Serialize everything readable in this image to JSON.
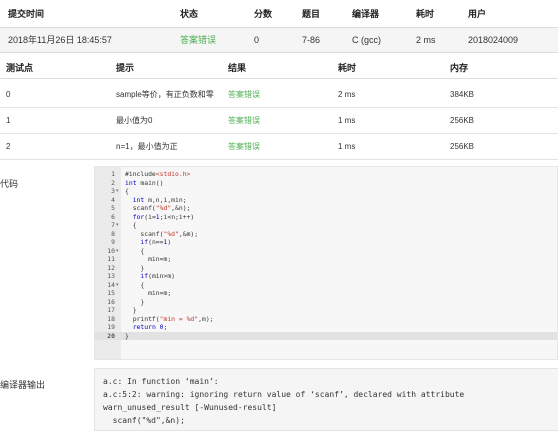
{
  "submission": {
    "headers": [
      "提交时间",
      "状态",
      "分数",
      "题目",
      "编译器",
      "耗时",
      "用户"
    ],
    "row": {
      "time": "2018年11月26日 18:45:57",
      "status": "答案错误",
      "score": "0",
      "problem": "7-86",
      "compiler": "C (gcc)",
      "duration": "2 ms",
      "user": "2018024009"
    }
  },
  "testcases": {
    "headers": [
      "测试点",
      "提示",
      "结果",
      "耗时",
      "内存"
    ],
    "rows": [
      {
        "id": "0",
        "hint": "sample等价，有正负数和零",
        "result": "答案错误",
        "time": "2 ms",
        "memory": "384KB"
      },
      {
        "id": "1",
        "hint": "最小值为0",
        "result": "答案错误",
        "time": "1 ms",
        "memory": "256KB"
      },
      {
        "id": "2",
        "hint": "n=1，最小值为正",
        "result": "答案错误",
        "time": "1 ms",
        "memory": "256KB"
      }
    ]
  },
  "code_label": "代码",
  "code_lines": [
    "#include<stdio.h>",
    "int main()",
    "{",
    "  int m,n,i,min;",
    "  scanf(\"%d\",&n);",
    "  for(i=1;i<n;i++)",
    "  {",
    "    scanf(\"%d\",&m);",
    "    if(n==1)",
    "    {",
    "      min=m;",
    "    }",
    "    if(min>m)",
    "    {",
    "      min=m;",
    "    }",
    "  }",
    "  printf(\"min = %d\",m);",
    "  return 0;",
    "}"
  ],
  "compile_label": "编译器输出",
  "compile_lines": [
    "a.c: In function ‘main’:",
    "a.c:5:2: warning: ignoring return value of ‘scanf’, declared with attribute",
    "warn_unused_result [-Wunused-result]",
    "  scanf(\"%d\",&n);"
  ],
  "colors": {
    "accent_green": "#4caf50",
    "header_row_bg": "#f5f5f5"
  }
}
